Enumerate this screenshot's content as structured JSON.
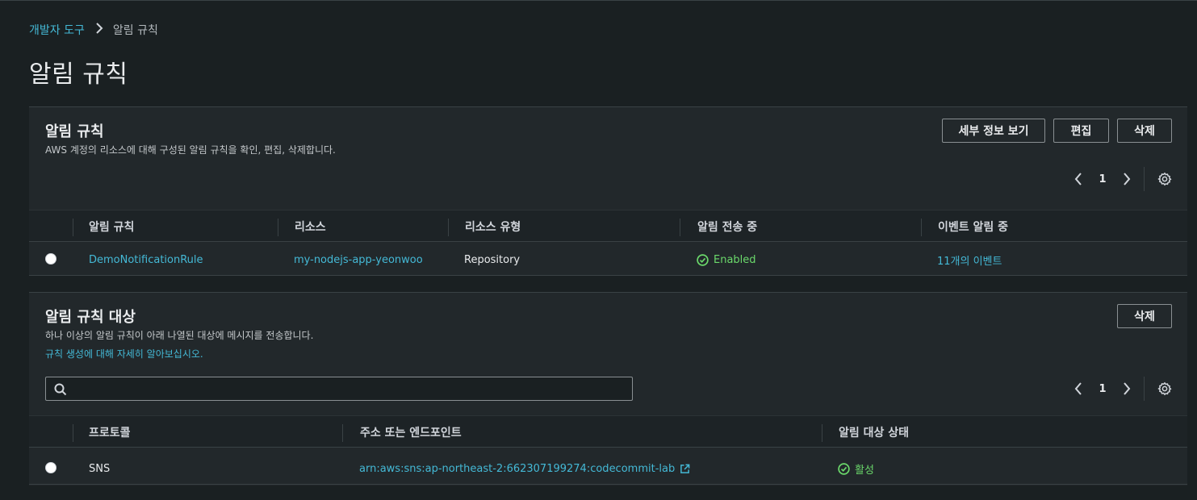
{
  "breadcrumb": {
    "parent": "개발자 도구",
    "current": "알림 규칙"
  },
  "page": {
    "title": "알림 규칙"
  },
  "rules_panel": {
    "title": "알림 규칙",
    "description": "AWS 계정의 리소스에 대해 구성된 알림 규칙을 확인, 편집, 삭제합니다.",
    "buttons": {
      "details": "세부 정보 보기",
      "edit": "편집",
      "delete": "삭제"
    },
    "pagination": {
      "page": "1"
    },
    "columns": [
      "알림 규칙",
      "리소스",
      "리소스 유형",
      "알림 전송 중",
      "이벤트 알림 중"
    ],
    "rows": [
      {
        "rule": "DemoNotificationRule",
        "resource": "my-nodejs-app-yeonwoo",
        "resource_type": "Repository",
        "status": "Enabled",
        "events": "11개의 이벤트"
      }
    ]
  },
  "targets_panel": {
    "title": "알림 규칙 대상",
    "description": "하나 이상의 알림 규칙이 아래 나열된 대상에 메시지를 전송합니다.",
    "learn_more": "규칙 생성에 대해 자세히 알아보십시오.",
    "buttons": {
      "delete": "삭제"
    },
    "search": {
      "placeholder": "",
      "value": ""
    },
    "pagination": {
      "page": "1"
    },
    "columns": [
      "프로토콜",
      "주소 또는 엔드포인트",
      "알림 대상 상태"
    ],
    "rows": [
      {
        "protocol": "SNS",
        "endpoint": "arn:aws:sns:ap-northeast-2:662307199274:codecommit-lab",
        "status": "활성"
      }
    ]
  },
  "colors": {
    "background": "#1a2022",
    "panel": "#22282b",
    "link": "#44b9d6",
    "success": "#6bd96b",
    "text": "#e9ebed"
  },
  "icons": [
    "chevron-right-icon",
    "chevron-left-icon",
    "gear-icon",
    "check-circle-icon",
    "search-icon",
    "external-link-icon"
  ]
}
